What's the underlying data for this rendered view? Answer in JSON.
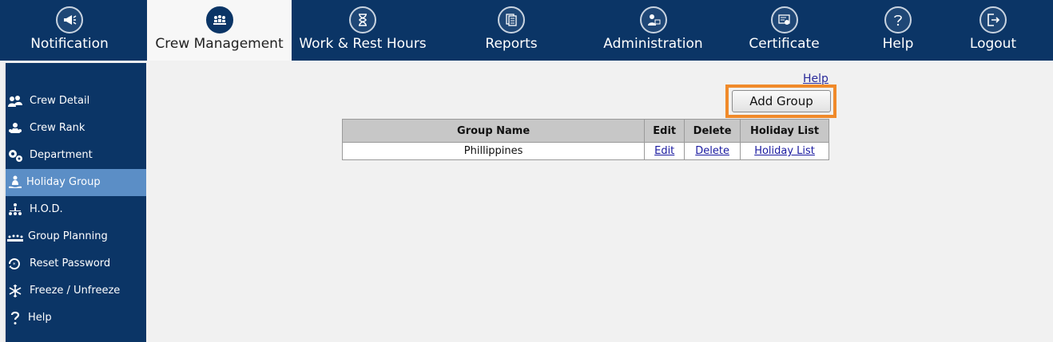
{
  "topnav": {
    "items": [
      {
        "label": "Notification",
        "icon": "megaphone-icon"
      },
      {
        "label": "Crew Management",
        "icon": "crew-group-icon",
        "active": true
      },
      {
        "label": "Work & Rest Hours",
        "icon": "hourglass-icon"
      },
      {
        "label": "Reports",
        "icon": "documents-icon"
      },
      {
        "label": "Administration",
        "icon": "admin-user-icon"
      },
      {
        "label": "Certificate",
        "icon": "certificate-icon"
      },
      {
        "label": "Help",
        "icon": "question-icon"
      },
      {
        "label": "Logout",
        "icon": "logout-icon"
      }
    ]
  },
  "sidebar": {
    "items": [
      {
        "label": "Crew Detail",
        "icon": "users-icon"
      },
      {
        "label": "Crew Rank",
        "icon": "rank-icon"
      },
      {
        "label": "Department",
        "icon": "gears-icon"
      },
      {
        "label": "Holiday Group",
        "icon": "meditation-icon",
        "active": true
      },
      {
        "label": "H.O.D.",
        "icon": "hierarchy-icon"
      },
      {
        "label": "Group Planning",
        "icon": "group-planning-icon"
      },
      {
        "label": "Reset Password",
        "icon": "reset-password-icon"
      },
      {
        "label": "Freeze / Unfreeze",
        "icon": "snowflake-icon"
      },
      {
        "label": "Help",
        "icon": "question-icon"
      }
    ]
  },
  "content": {
    "help_link": "Help",
    "add_group_button": "Add Group"
  },
  "table": {
    "headers": [
      "Group Name",
      "Edit",
      "Delete",
      "Holiday List"
    ],
    "rows": [
      {
        "group_name": "Phillippines",
        "edit": "Edit",
        "delete": "Delete",
        "holiday_list": "Holiday List"
      }
    ]
  },
  "colors": {
    "nav_background": "#0b3566",
    "sidebar_active": "#5b8ec6",
    "highlight_frame": "#f08a2a"
  }
}
